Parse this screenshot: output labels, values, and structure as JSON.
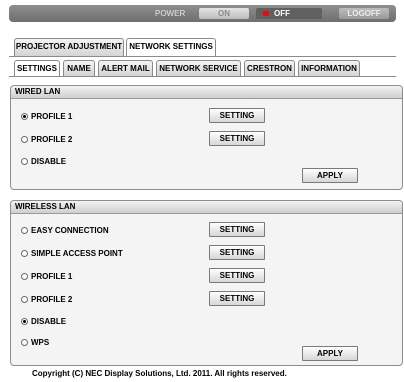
{
  "topbar": {
    "power_label": "POWER",
    "on_label": "ON",
    "off_label": "OFF",
    "logoff_label": "LOGOFF"
  },
  "main_tabs": [
    {
      "label": "PROJECTOR ADJUSTMENT",
      "active": false
    },
    {
      "label": "NETWORK SETTINGS",
      "active": true
    }
  ],
  "sub_tabs": [
    {
      "label": "SETTINGS",
      "active": true
    },
    {
      "label": "NAME",
      "active": false
    },
    {
      "label": "ALERT MAIL",
      "active": false
    },
    {
      "label": "NETWORK SERVICE",
      "active": false
    },
    {
      "label": "CRESTRON",
      "active": false
    },
    {
      "label": "INFORMATION",
      "active": false
    }
  ],
  "wired": {
    "title": "WIRED LAN",
    "options": [
      {
        "label": "PROFILE 1",
        "selected": true
      },
      {
        "label": "PROFILE 2",
        "selected": false
      },
      {
        "label": "DISABLE",
        "selected": false
      }
    ],
    "setting_label": "SETTING",
    "apply_label": "APPLY"
  },
  "wireless": {
    "title": "WIRELESS LAN",
    "options": [
      {
        "label": "EASY CONNECTION",
        "selected": false
      },
      {
        "label": "SIMPLE ACCESS POINT",
        "selected": false
      },
      {
        "label": "PROFILE 1",
        "selected": false
      },
      {
        "label": "PROFILE 2",
        "selected": false
      },
      {
        "label": "DISABLE",
        "selected": true
      },
      {
        "label": "WPS",
        "selected": false
      }
    ],
    "setting_label": "SETTING",
    "apply_label": "APPLY"
  },
  "footer": {
    "copyright": "Copyright (C) NEC Display Solutions, Ltd. 2011. All rights reserved."
  }
}
